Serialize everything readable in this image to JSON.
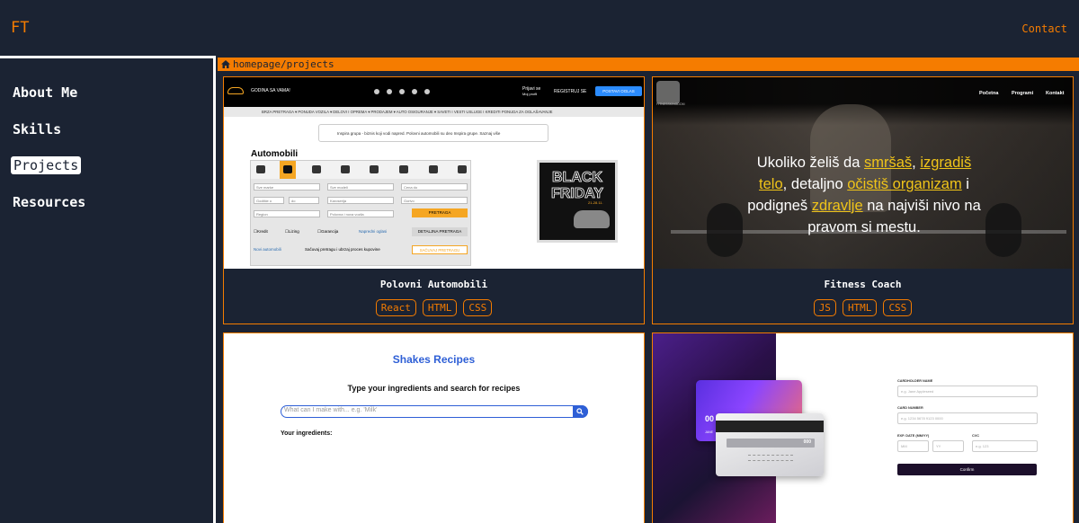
{
  "header": {
    "logo": "FT",
    "contact": "Contact"
  },
  "sidebar": {
    "items": [
      {
        "label": "About Me"
      },
      {
        "label": "Skills"
      },
      {
        "label": "Projects",
        "active": true
      },
      {
        "label": "Resources"
      }
    ]
  },
  "breadcrumb": {
    "root": "homepage",
    "separator": "/",
    "current": "projects",
    "icon": "home-icon"
  },
  "projects": [
    {
      "title": "Polovni Automobili",
      "tags": [
        "React",
        "HTML",
        "CSS"
      ],
      "preview": {
        "brand": "GODINA SA VAMA!",
        "login": "Prijavi se",
        "login_sub": "Moj profil",
        "register": "REGISTRUJ SE",
        "post_ad": "POSTAVI OGLAS",
        "menu": "BRZA PRETRAGA ▾   PONUDA VOZILA ▾   DELOVI I OPREMA ▾   PRODAJEM ▾   AUTO OSIGURANJE ▾   SAVETI I VESTI   USLUGE I KREDITI   PONUDA ZA OGLAŠAVANJE",
        "promo": "Inspira grupa - biznis koji vodi napred. Polovni automobili su deo Inspira grupe.   Saznaj više",
        "section_title": "Automobili",
        "fields": [
          "Sve marke",
          "Sve modeli",
          "Cena do",
          "Godište o",
          "do",
          "Karoserija",
          "Gorivo",
          "Region",
          "Polovna i nova vozila"
        ],
        "search_btn": "PRETRAGA",
        "detailed_btn": "DETALJNA PRETRAGA",
        "checkboxes": [
          "Kredit",
          "Lizing",
          "Garancija"
        ],
        "new_ads": "Napredni oglasi",
        "save_text": "Sačuvaj pretragu i ubrzaj proces kupovine",
        "new_cars": "Novi automobili",
        "save_btn": "SAČUVAJ PRETRAGU",
        "banner_title": "BLACK FRIDAY",
        "banner_date": "21-28.11."
      }
    },
    {
      "title": "Fitness Coach",
      "tags": [
        "JS",
        "HTML",
        "CSS"
      ],
      "preview": {
        "logo_text": "FITNESSKINGDOM",
        "nav": [
          "Početna",
          "Programi",
          "Kontakt"
        ],
        "hero": [
          {
            "t": "Ukoliko želiš da ",
            "hl": false
          },
          {
            "t": "smršaš",
            "hl": true
          },
          {
            "t": ", ",
            "hl": false
          },
          {
            "t": "izgradiš telo",
            "hl": true
          },
          {
            "t": ", detaljno ",
            "hl": false
          },
          {
            "t": "očistiš organizam",
            "hl": true
          },
          {
            "t": " i podigneš ",
            "hl": false
          },
          {
            "t": "zdravlje",
            "hl": true
          },
          {
            "t": " na najviši nivo na pravom si mestu.",
            "hl": false
          }
        ]
      }
    },
    {
      "title": "",
      "tags": [],
      "preview": {
        "heading": "Shakes Recipes",
        "subheading": "Type your ingredients and search for recipes",
        "search_placeholder": "What can I make with... e.g. 'Milk'",
        "ingredients_label": "Your ingredients:"
      }
    },
    {
      "title": "",
      "tags": [],
      "preview": {
        "card_number_front": "00",
        "card_name_front": "JANE",
        "cvc_back": "000",
        "labels": {
          "name": "CARDHOLDER NAME",
          "number": "CARD NUMBER",
          "exp": "EXP. DATE (MM/YY)",
          "cvc": "CVC"
        },
        "placeholders": {
          "name": "e.g. Jane Appleseed",
          "number": "e.g. 1234 5678 9123 0000",
          "mm": "MM",
          "yy": "YY",
          "cvc": "e.g. 123"
        },
        "confirm": "Confirm"
      }
    }
  ],
  "colors": {
    "accent": "#f57c00",
    "background": "#1b2333",
    "text": "#ffffff"
  }
}
